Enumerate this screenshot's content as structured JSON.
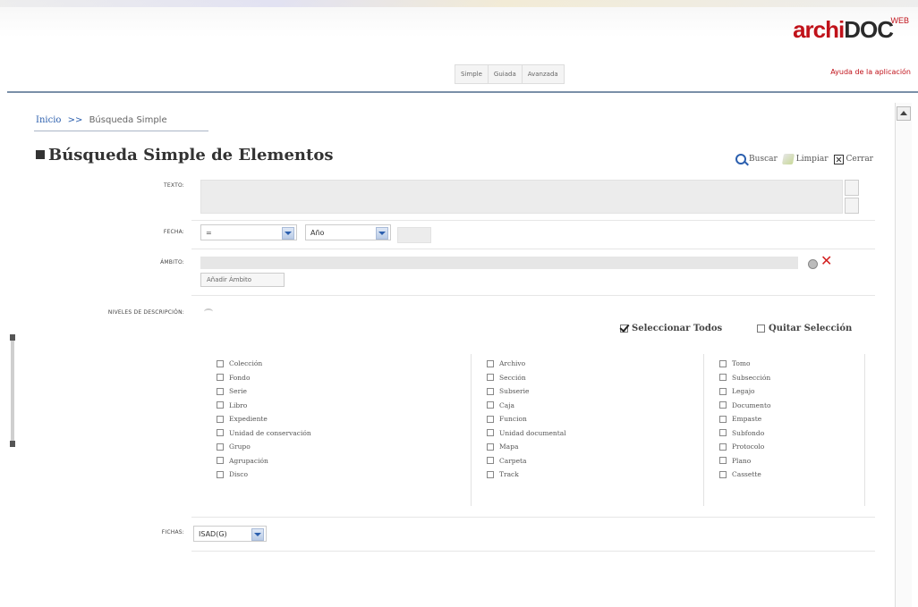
{
  "header": {
    "logo_part1": "archi",
    "logo_part2": "DOC",
    "logo_sup": "WEB",
    "modes": [
      "Simple",
      "Guiada",
      "Avanzada"
    ],
    "help": "Ayuda de la aplicación"
  },
  "breadcrumb": {
    "home": "Inicio",
    "separator": ">>",
    "current": "Búsqueda Simple"
  },
  "page": {
    "title": "Búsqueda Simple de Elementos",
    "actions": {
      "search": "Buscar",
      "clear": "Limpiar",
      "close": "Cerrar"
    }
  },
  "form": {
    "texto_label": "TEXTO:",
    "fecha_label": "FECHA:",
    "fecha_operator": "=",
    "fecha_unit": "Año",
    "ambito_label": "ÁMBITO:",
    "ambito_button": "Añadir Ámbito",
    "niveles_label": "NIVELES DE DESCRIPCIÓN:",
    "select_all": "Seleccionar Todos",
    "deselect_all": "Quitar Selección",
    "levels": [
      [
        "Colección",
        "Fondo",
        "Serie",
        "Libro",
        "Expediente",
        "Unidad de conservación",
        "Grupo",
        "Agrupación",
        "Disco"
      ],
      [
        "Archivo",
        "Sección",
        "Subserie",
        "Caja",
        "Funcion",
        "Unidad documental",
        "Mapa",
        "Carpeta",
        "Track"
      ],
      [
        "Tomo",
        "Subsección",
        "Legajo",
        "Documento",
        "Empaste",
        "Subfondo",
        "Protocolo",
        "Plano",
        "Cassette"
      ]
    ],
    "fichas_label": "FICHAS:",
    "fichas_value": "ISAD(G)"
  },
  "colors": {
    "brand_red": "#c0121a",
    "link_blue": "#2b5fae"
  }
}
